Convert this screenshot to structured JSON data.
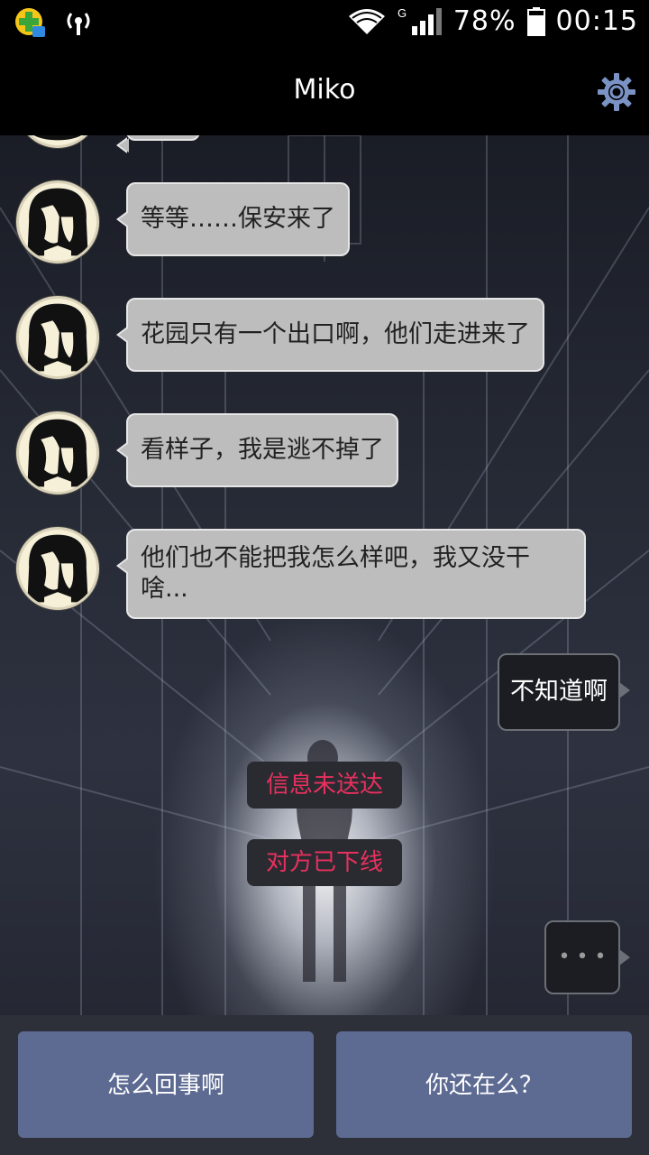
{
  "status_bar": {
    "signal_type": "G",
    "battery": "78%",
    "time": "00:15",
    "icons": [
      "app-plus-icon",
      "hotspot-icon",
      "wifi-icon",
      "cell-signal-icon",
      "battery-icon"
    ]
  },
  "header": {
    "title": "Miko",
    "settings_icon": "gear-icon"
  },
  "messages": [
    {
      "from": "Miko",
      "text": "等等……保安来了"
    },
    {
      "from": "Miko",
      "text": "花园只有一个出口啊，他们走进来了"
    },
    {
      "from": "Miko",
      "text": "看样子，我是逃不掉了"
    },
    {
      "from": "Miko",
      "text": "他们也不能把我怎么样吧，我又没干啥..."
    },
    {
      "from": "me",
      "text": "不知道啊"
    }
  ],
  "notices": [
    "信息未送达",
    "对方已下线"
  ],
  "typing_indicator": "• • •",
  "reply_options": [
    "怎么回事啊",
    "你还在么？"
  ],
  "colors": {
    "notice_text": "#e8305f",
    "reply_button": "#5d6b93",
    "incoming_bubble": "#bdbdbd",
    "outgoing_bubble": "#1b1d22"
  }
}
